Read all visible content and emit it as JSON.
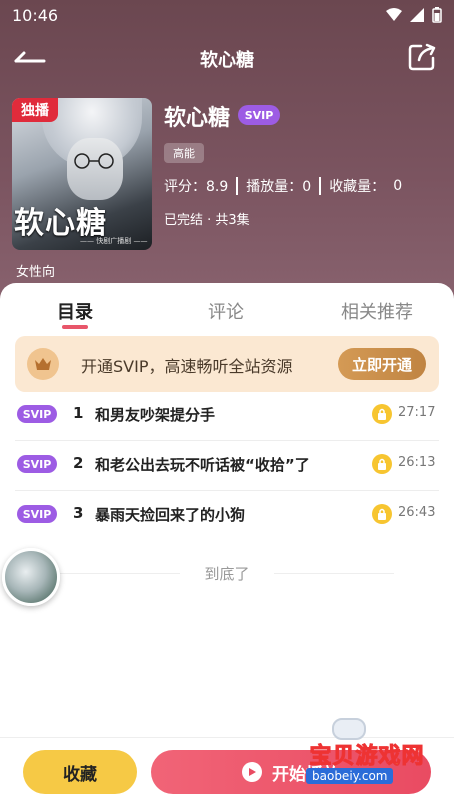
{
  "status_bar": {
    "time": "10:46"
  },
  "header": {
    "title": "软心糖"
  },
  "album": {
    "exclusive_badge": "独播",
    "cover_title": "软心糖",
    "cover_caption": "—— 快剧广播剧 ——",
    "title": "软心糖",
    "svip_badge": "SVIP",
    "tag": "高能",
    "rating_label": "评分：8.9",
    "plays_label": "播放量：0",
    "favorites_label": "收藏量：",
    "favorites_value": "0",
    "finished": "已完结 · 共3集",
    "audience": "女性向"
  },
  "tabs": [
    {
      "label": "目录",
      "active": true
    },
    {
      "label": "评论",
      "active": false
    },
    {
      "label": "相关推荐",
      "active": false
    }
  ],
  "promo": {
    "text": "开通SVIP，高速畅听全站资源",
    "button": "立即开通"
  },
  "episodes": [
    {
      "badge": "SVIP",
      "num": "1",
      "title": "和男友吵架提分手",
      "duration": "27:17"
    },
    {
      "badge": "SVIP",
      "num": "2",
      "title": "和老公出去玩不听话被“收拾”了",
      "duration": "26:13"
    },
    {
      "badge": "SVIP",
      "num": "3",
      "title": "暴雨天捡回来了的小狗",
      "duration": "26:43"
    }
  ],
  "end_text": "到底了",
  "bottom": {
    "collect": "收藏",
    "play": "开始播放"
  },
  "watermark": {
    "text": "宝贝游戏网",
    "url": "baobeiy.com"
  },
  "colors": {
    "accent": "#e94b62",
    "svip": "#9d5ce4",
    "gold": "#f6c945",
    "header_bg": "#6b4750"
  }
}
